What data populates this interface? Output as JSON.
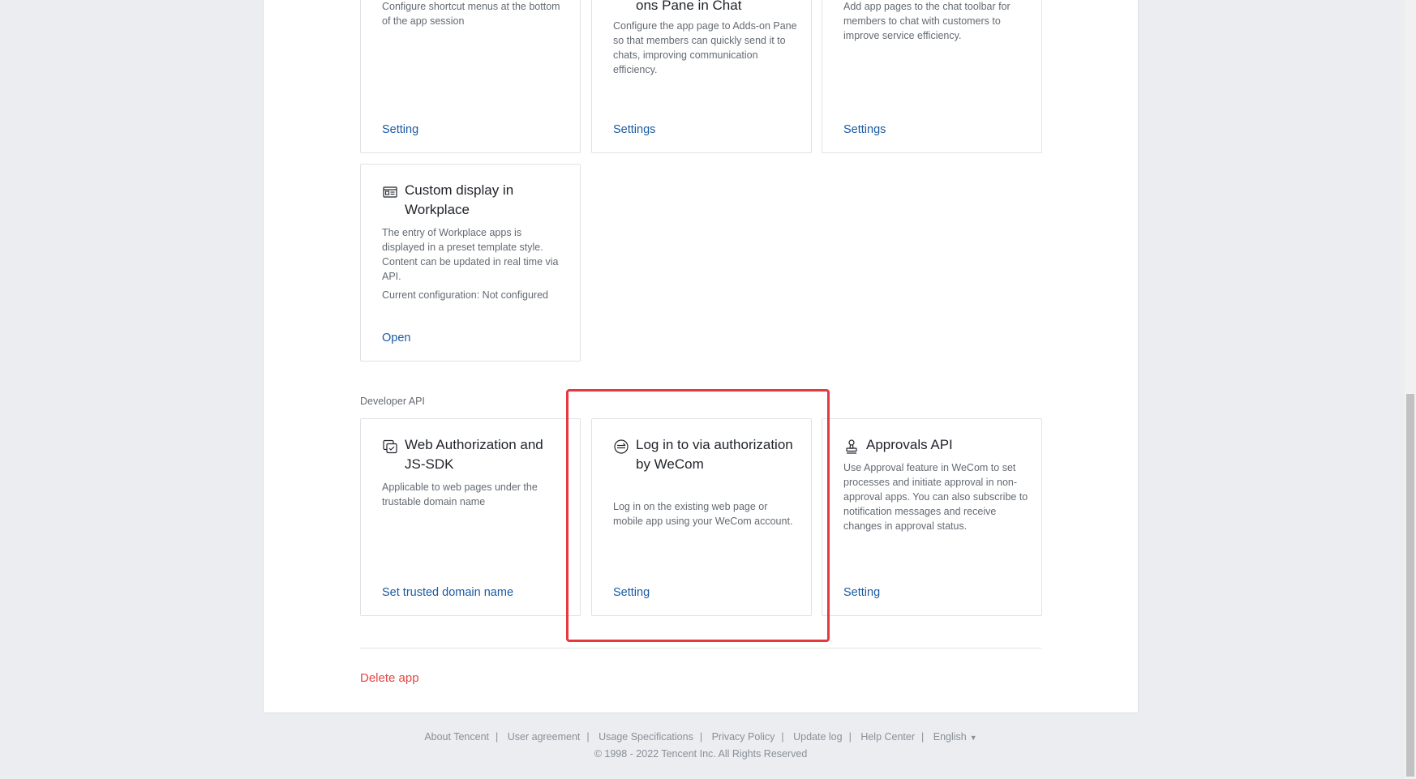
{
  "top_cards": [
    {
      "desc": "Configure shortcut menus at the bottom of the app session",
      "link": "Setting"
    },
    {
      "title_fragment": "ons Pane in Chat",
      "desc": "Configure the app page to Adds-on Pane so that members can quickly send it to chats, improving communication efficiency.",
      "link": "Settings"
    },
    {
      "desc": "Add app pages to the chat toolbar for members to chat with customers to improve service efficiency.",
      "link": "Settings"
    }
  ],
  "workplace_card": {
    "title": "Custom display in Workplace",
    "desc": "The entry of Workplace apps is displayed in a preset template style. Content can be updated in real time via API.",
    "config": "Current configuration: Not configured",
    "link": "Open",
    "icon": "layout-icon"
  },
  "developer_api": {
    "label": "Developer API",
    "cards": [
      {
        "title": "Web Authorization and JS-SDK",
        "desc": "Applicable to web pages under the trustable domain name",
        "link": "Set trusted domain name",
        "icon": "copy-window-icon"
      },
      {
        "title": "Log in to via authorization by WeCom",
        "desc": "Log in on the existing web page or mobile app using your WeCom account.",
        "link": "Setting",
        "icon": "login-circle-icon"
      },
      {
        "title": "Approvals API",
        "desc": "Use Approval feature in WeCom to set processes and initiate approval in non-approval apps. You can also subscribe to notification messages and receive changes in approval status.",
        "link": "Setting",
        "icon": "stamp-icon"
      }
    ]
  },
  "delete_app": "Delete app",
  "footer": {
    "links": [
      "About Tencent",
      "User agreement",
      "Usage Specifications",
      "Privacy Policy",
      "Update log",
      "Help Center"
    ],
    "language": "English",
    "copyright": "© 1998 - 2022 Tencent Inc. All Rights Reserved"
  },
  "colors": {
    "link": "#1a5aa3",
    "danger": "#e54545",
    "highlight": "#e5393f"
  }
}
